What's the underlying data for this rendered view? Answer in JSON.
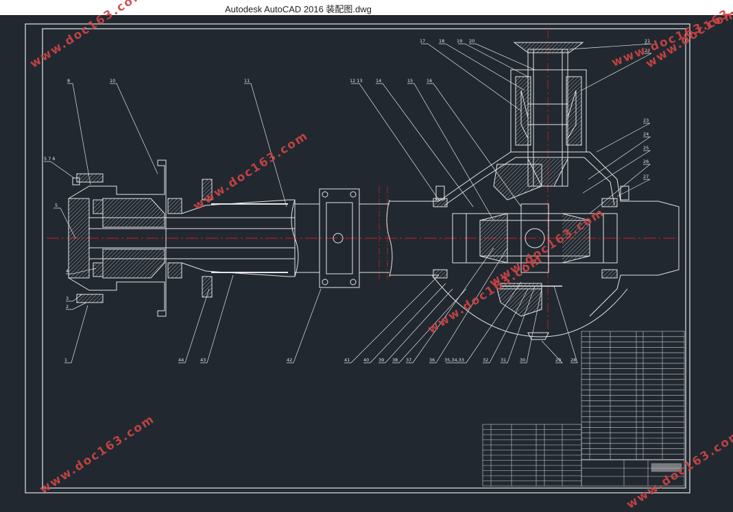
{
  "window": {
    "title": "Autodesk AutoCAD 2016     装配图.dwg"
  },
  "watermarks": [
    "www.doc163.com",
    "www.doc163.com",
    "www.doc163.com",
    "www.doc163.com",
    "www.doc163.com",
    "www.doc163.com",
    "www.doc163.com",
    "www.doc163.com"
  ],
  "part_labels": {
    "top_left": [
      "8",
      "10",
      "11",
      "12 13",
      "14",
      "15",
      "16"
    ],
    "top_right": [
      "17",
      "18",
      "19",
      "20",
      "21",
      "22"
    ],
    "left_side": [
      "5 7 6",
      "5",
      "4",
      "3",
      "2",
      "1"
    ],
    "right_side": [
      "23",
      "24",
      "25",
      "26",
      "27"
    ],
    "bottom": [
      "44",
      "43",
      "42",
      "41",
      "40",
      "39",
      "38",
      "37",
      "36",
      "35,34,33",
      "32",
      "31",
      "30",
      "29",
      "28"
    ]
  },
  "colors": {
    "background": "#212830",
    "line": "#e8e8e8",
    "center_line": "#d42020",
    "watermark": "#d04545"
  }
}
